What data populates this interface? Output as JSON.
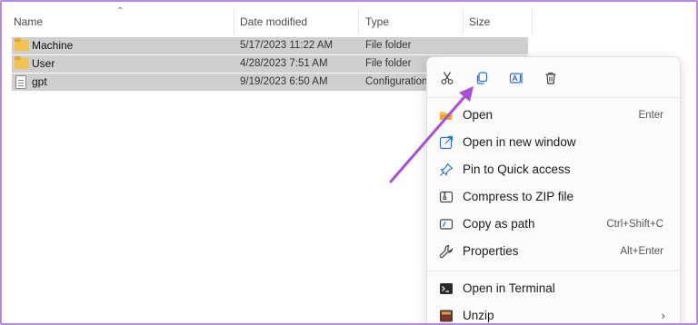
{
  "columns": {
    "name": "Name",
    "date_modified": "Date modified",
    "type": "Type",
    "size": "Size"
  },
  "files": [
    {
      "name": "Machine",
      "date": "5/17/2023 11:22 AM",
      "type": "File folder",
      "icon": "folder-icon"
    },
    {
      "name": "User",
      "date": "4/28/2023 7:51 AM",
      "type": "File folder",
      "icon": "folder-icon"
    },
    {
      "name": "gpt",
      "date": "9/19/2023 6:50 AM",
      "type": "Configuration",
      "icon": "file-icon"
    }
  ],
  "context_menu": {
    "toolbar": [
      "cut-icon",
      "copy-icon",
      "rename-icon",
      "delete-icon"
    ],
    "items": [
      {
        "label": "Open",
        "shortcut": "Enter",
        "icon": "folder-open-icon"
      },
      {
        "label": "Open in new window",
        "shortcut": "",
        "icon": "external-window-icon"
      },
      {
        "label": "Pin to Quick access",
        "shortcut": "",
        "icon": "pin-icon"
      },
      {
        "label": "Compress to ZIP file",
        "shortcut": "",
        "icon": "zip-icon"
      },
      {
        "label": "Copy as path",
        "shortcut": "Ctrl+Shift+C",
        "icon": "path-icon"
      },
      {
        "label": "Properties",
        "shortcut": "Alt+Enter",
        "icon": "wrench-icon"
      },
      {
        "label": "Open in Terminal",
        "shortcut": "",
        "icon": "terminal-icon"
      },
      {
        "label": "Unzip",
        "shortcut": "",
        "icon": "unzip-icon"
      }
    ]
  },
  "colors": {
    "selection": "#cfcfcf",
    "annotation_arrow": "#a94fd6",
    "frame_border": "#b48be0",
    "icon_blue": "#2f6fc7"
  }
}
